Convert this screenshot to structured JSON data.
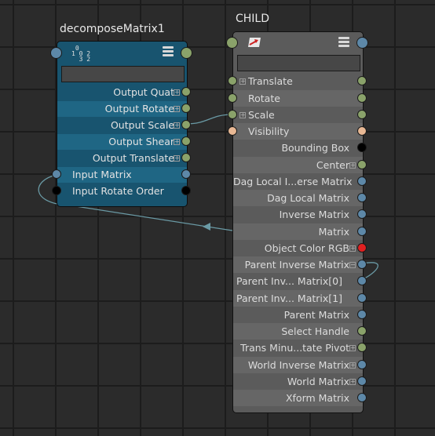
{
  "graph": {
    "decompose_node": {
      "title": "decomposeMatrix1",
      "icon": "decompose-matrix-icon",
      "outputs": [
        "Output Quat",
        "Output Rotate",
        "Output Scale",
        "Output Shear",
        "Output Translate"
      ],
      "inputs": [
        "Input Matrix",
        "Input Rotate Order"
      ]
    },
    "child_node": {
      "title": "CHILD",
      "icon": "transform-icon",
      "attributes": [
        "Translate",
        "Rotate",
        "Scale",
        "Visibility",
        "Bounding Box",
        "Center",
        "Dag Local I...erse Matrix",
        "Dag Local Matrix",
        "Inverse Matrix",
        "Matrix",
        "Object Color RGB",
        "Parent Inverse Matrix",
        "Parent Inv... Matrix[0]",
        "Parent Inv... Matrix[1]",
        "Parent Matrix",
        "Select Handle",
        "Trans Minu...tate Pivot",
        "World Inverse Matrix",
        "World Matrix",
        "Xform Matrix"
      ]
    },
    "colors": {
      "matrix_port": "#5d88a8",
      "vector_port": "#8aa26a",
      "bool_port": "#e8b894",
      "color_port": "#e02020",
      "enum_port": "#000000",
      "wire": "#6a9aa5"
    }
  }
}
